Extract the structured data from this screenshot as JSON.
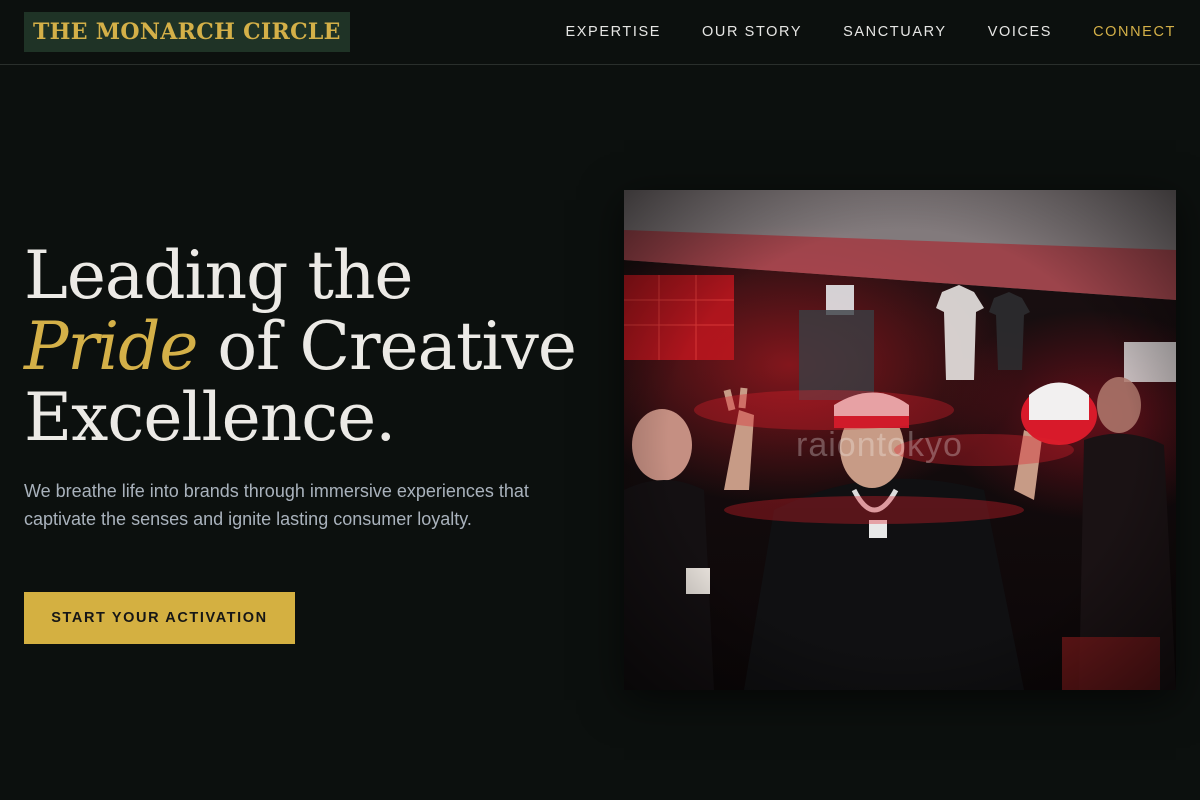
{
  "brand": {
    "logo_text": "THE MONARCH CIRCLE"
  },
  "nav": {
    "items": [
      {
        "label": "EXPERTISE"
      },
      {
        "label": "OUR STORY"
      },
      {
        "label": "SANCTUARY"
      },
      {
        "label": "VOICES"
      },
      {
        "label": "CONNECT"
      }
    ]
  },
  "hero": {
    "headline_line1": "Leading the",
    "headline_accent": "Pride",
    "headline_line2_rest": " of Creative",
    "headline_line3": "Excellence.",
    "subtext": "We breathe life into brands through immersive experiences that captivate the senses and ignite lasting consumer loyalty.",
    "cta_label": "START YOUR ACTIVATION",
    "image_watermark": "raiontokyo"
  },
  "colors": {
    "background": "#0c100e",
    "accent_gold": "#d4b048",
    "logo_bg": "#1f3326",
    "subtext": "#a9b2bc"
  }
}
